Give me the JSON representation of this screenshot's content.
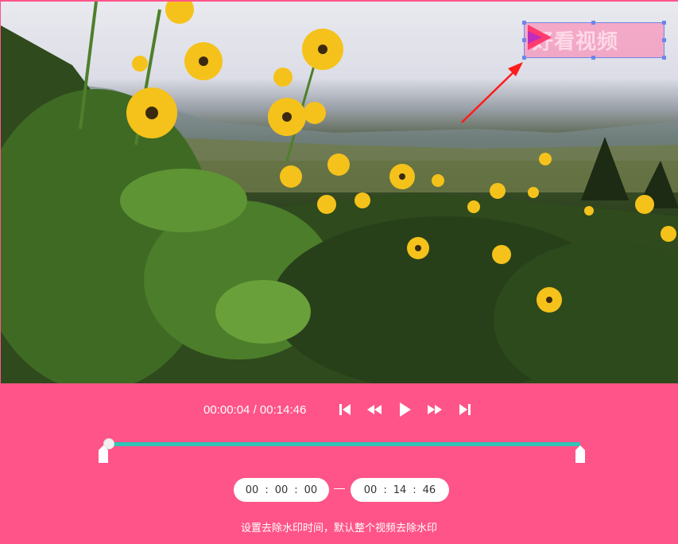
{
  "player": {
    "current_time": "00:00:04",
    "separator": "/",
    "total_time": "00:14:46",
    "progress_fraction": 0.0,
    "accent_color": "#2ec4b6",
    "background_color": "#ff5489"
  },
  "watermark": {
    "text": "好看视频",
    "logo_icon": "play-triangle-logo-icon"
  },
  "controls": {
    "icons": [
      "skip-to-start-icon",
      "rewind-icon",
      "play-icon",
      "fast-forward-icon",
      "skip-to-end-icon"
    ]
  },
  "range": {
    "start": {
      "hh": "00",
      "mm": "00",
      "ss": "00"
    },
    "end": {
      "hh": "00",
      "mm": "14",
      "ss": "46"
    },
    "colon": ":"
  },
  "hint": "设置去除水印时间，默认整个视频去除水印"
}
